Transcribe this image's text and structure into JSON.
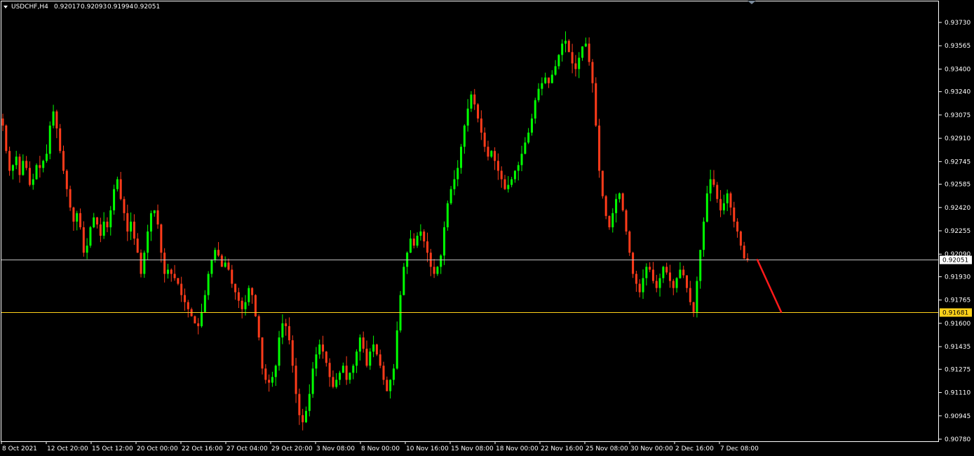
{
  "header": {
    "symbol_timeframe": "USDCHF,H4",
    "open": "0.92017",
    "high": "0.92093",
    "low": "0.91994",
    "close": "0.92051"
  },
  "colors": {
    "background": "#000000",
    "frame": "#ffffff",
    "bull_candle": "#00ff00",
    "bear_candle": "#ff3b1a",
    "bid_line": "#c0c0c0",
    "level_line": "#ffd21a",
    "level_label_bg": "#ffd21a",
    "projection_arrow": "#ff1a1a",
    "text": "#ffffff"
  },
  "chart_data": {
    "type": "candlestick",
    "title": "USDCHF,H4",
    "ylim": [
      0.9078,
      0.9381
    ],
    "y_ticks": [
      "0.93730",
      "0.93565",
      "0.93400",
      "0.93240",
      "0.93075",
      "0.92910",
      "0.92745",
      "0.92585",
      "0.92420",
      "0.92255",
      "0.92090",
      "0.91930",
      "0.91765",
      "0.91600",
      "0.91435",
      "0.91275",
      "0.91110",
      "0.90945",
      "0.90780"
    ],
    "x_ticks": [
      "8 Oct 2021",
      "12 Oct 20:00",
      "15 Oct 12:00",
      "20 Oct 00:00",
      "22 Oct 16:00",
      "27 Oct 04:00",
      "29 Oct 20:00",
      "3 Nov 08:00",
      "8 Nov 00:00",
      "10 Nov 16:00",
      "15 Nov 08:00",
      "18 Nov 00:00",
      "22 Nov 16:00",
      "25 Nov 08:00",
      "30 Nov 00:00",
      "2 Dec 16:00",
      "7 Dec 08:00"
    ],
    "price_markers": [
      {
        "label": "0.92051",
        "value": 0.92051,
        "kind": "bid"
      },
      {
        "label": "0.91681",
        "value": 0.91681,
        "kind": "level"
      }
    ],
    "projection": {
      "from_value": 0.9205,
      "to_value": 0.9168,
      "direction": "down"
    },
    "close_path": [
      0.93,
      0.9282,
      0.9268,
      0.9272,
      0.9278,
      0.9265,
      0.9275,
      0.927,
      0.9258,
      0.9262,
      0.9272,
      0.927,
      0.9275,
      0.928,
      0.93,
      0.931,
      0.9298,
      0.9282,
      0.9268,
      0.9255,
      0.9242,
      0.9232,
      0.9238,
      0.9228,
      0.921,
      0.9215,
      0.9228,
      0.9235,
      0.923,
      0.9222,
      0.9232,
      0.9228,
      0.924,
      0.9255,
      0.9262,
      0.9248,
      0.9238,
      0.9225,
      0.9232,
      0.922,
      0.921,
      0.9195,
      0.921,
      0.9225,
      0.9238,
      0.924,
      0.923,
      0.921,
      0.9195,
      0.9198,
      0.9195,
      0.9192,
      0.9188,
      0.918,
      0.9175,
      0.917,
      0.9165,
      0.916,
      0.9158,
      0.9168,
      0.918,
      0.9195,
      0.9205,
      0.9212,
      0.9208,
      0.92,
      0.9203,
      0.9198,
      0.9188,
      0.9182,
      0.9176,
      0.917,
      0.9175,
      0.9185,
      0.918,
      0.9165,
      0.915,
      0.9128,
      0.912,
      0.9118,
      0.9122,
      0.913,
      0.915,
      0.916,
      0.9158,
      0.9148,
      0.913,
      0.911,
      0.9095,
      0.909,
      0.9098,
      0.911,
      0.9128,
      0.9138,
      0.9145,
      0.914,
      0.9132,
      0.9122,
      0.9115,
      0.912,
      0.9125,
      0.913,
      0.912,
      0.9125,
      0.913,
      0.914,
      0.915,
      0.9142,
      0.913,
      0.914,
      0.9145,
      0.9138,
      0.913,
      0.912,
      0.9112,
      0.912,
      0.9128,
      0.9155,
      0.918,
      0.92,
      0.921,
      0.922,
      0.9215,
      0.9222,
      0.9225,
      0.9218,
      0.921,
      0.92,
      0.9195,
      0.92,
      0.9208,
      0.9228,
      0.9245,
      0.9255,
      0.9262,
      0.927,
      0.9285,
      0.93,
      0.9312,
      0.9322,
      0.9315,
      0.9305,
      0.9295,
      0.9285,
      0.9278,
      0.9282,
      0.9275,
      0.9268,
      0.9262,
      0.9255,
      0.9258,
      0.9262,
      0.9268,
      0.9272,
      0.928,
      0.9288,
      0.9295,
      0.9305,
      0.9318,
      0.9326,
      0.933,
      0.9334,
      0.933,
      0.9336,
      0.9342,
      0.935,
      0.9358,
      0.936,
      0.9352,
      0.9344,
      0.934,
      0.9348,
      0.9356,
      0.9358,
      0.9345,
      0.933,
      0.93,
      0.9268,
      0.925,
      0.9236,
      0.9228,
      0.9238,
      0.9248,
      0.9252,
      0.924,
      0.9225,
      0.921,
      0.9195,
      0.9188,
      0.9182,
      0.9192,
      0.92,
      0.9198,
      0.919,
      0.9185,
      0.9192,
      0.92,
      0.9196,
      0.919,
      0.9185,
      0.9192,
      0.9198,
      0.9194,
      0.9185,
      0.9175,
      0.9168,
      0.919,
      0.9212,
      0.9232,
      0.9252,
      0.9262,
      0.9258,
      0.9248,
      0.924,
      0.9245,
      0.9252,
      0.9242,
      0.9232,
      0.9225,
      0.9215,
      0.9206,
      0.9205
    ]
  }
}
